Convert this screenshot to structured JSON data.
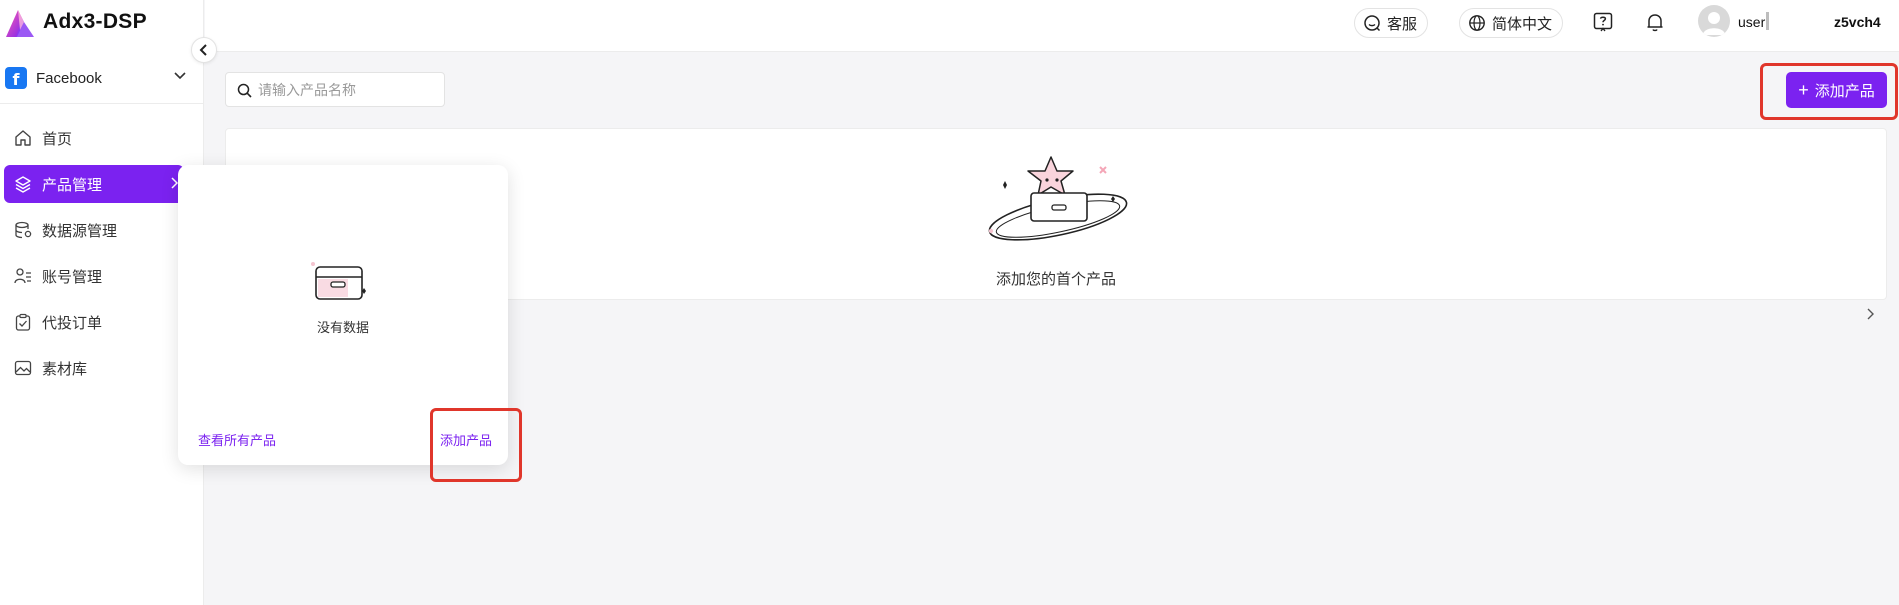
{
  "app": {
    "title": "Adx3-DSP",
    "accent": "#7b22f0",
    "highlight": "#e0362b"
  },
  "platform": {
    "label": "Facebook",
    "icon": "facebook-icon"
  },
  "sidebar": {
    "items": [
      {
        "label": "首页",
        "icon": "home-icon"
      },
      {
        "label": "产品管理",
        "icon": "layers-icon",
        "active": true
      },
      {
        "label": "数据源管理",
        "icon": "database-icon"
      },
      {
        "label": "账号管理",
        "icon": "user-list-icon"
      },
      {
        "label": "代投订单",
        "icon": "clipboard-check-icon"
      },
      {
        "label": "素材库",
        "icon": "image-icon"
      }
    ]
  },
  "header": {
    "support_label": "客服",
    "language_label": "简体中文",
    "username": "user",
    "account": "z5vch4"
  },
  "main": {
    "search_placeholder": "请输入产品名称",
    "add_button_label": "添加产品",
    "empty_text": "添加您的首个产品"
  },
  "popover": {
    "empty_text": "没有数据",
    "view_all_label": "查看所有产品",
    "add_label": "添加产品"
  }
}
